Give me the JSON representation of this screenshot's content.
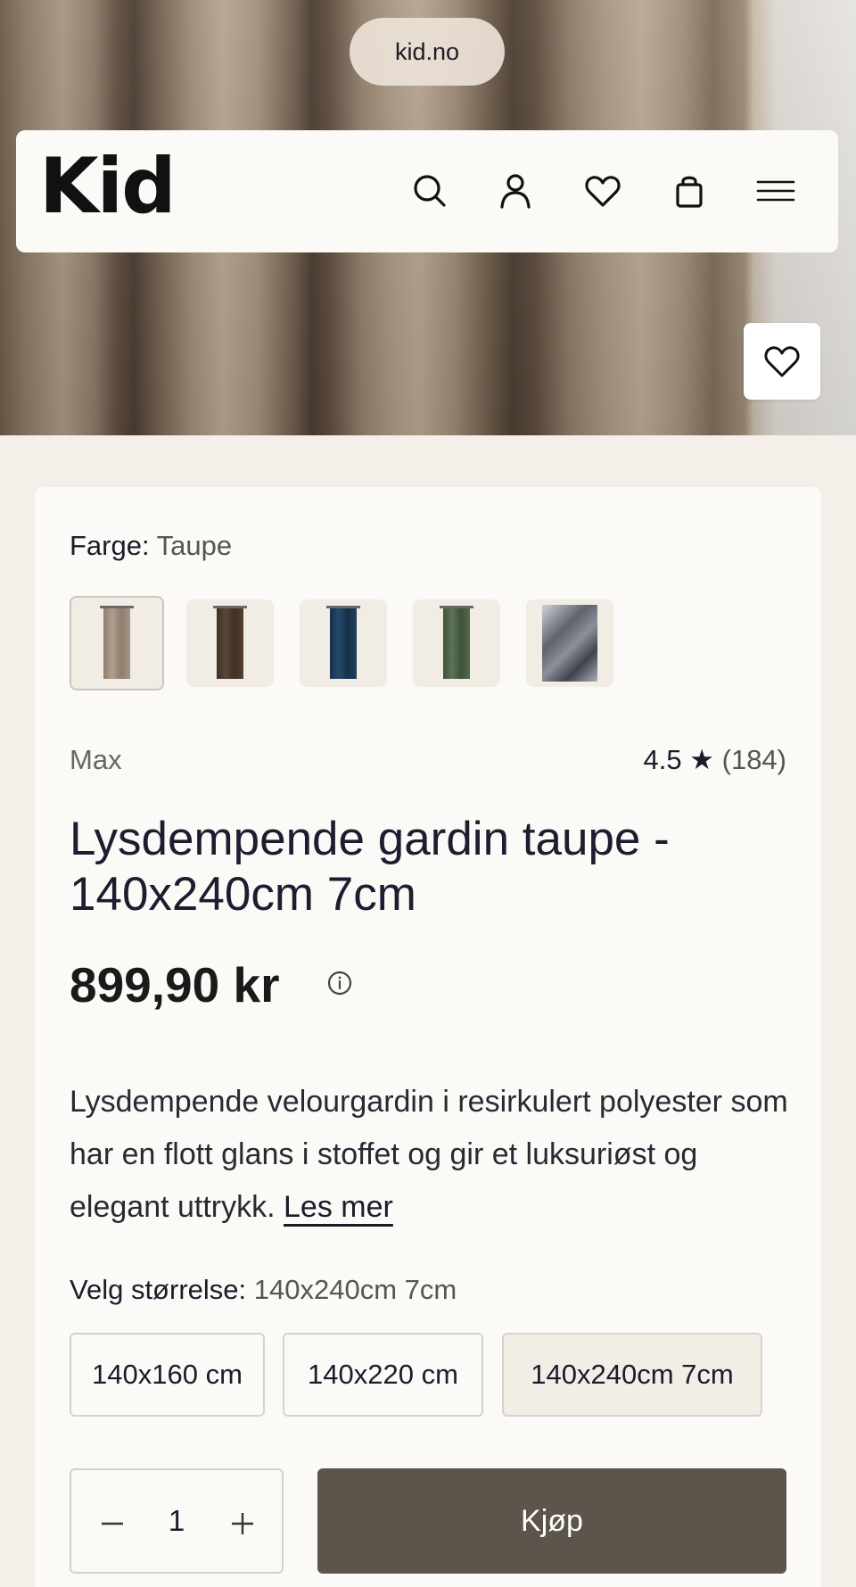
{
  "browser": {
    "url": "kid.no"
  },
  "header": {
    "logo": "Kid",
    "icons": [
      "search-icon",
      "account-icon",
      "heart-icon",
      "bag-icon",
      "menu-icon"
    ]
  },
  "colors": {
    "button_dark": "#5d554c",
    "card_bg": "#fbfaf7",
    "page_bg": "#f4f0e9"
  },
  "product": {
    "color_label": "Farge:",
    "color_value": "Taupe",
    "swatches": [
      {
        "name": "Taupe",
        "color": "#9e8e7e",
        "selected": true
      },
      {
        "name": "Brown",
        "color": "#4a3a2e",
        "selected": false
      },
      {
        "name": "Blue",
        "color": "#1f3a52",
        "selected": false
      },
      {
        "name": "Green",
        "color": "#4e6247",
        "selected": false
      },
      {
        "name": "Photo",
        "color": "#6b7079",
        "selected": false
      }
    ],
    "brand": "Max",
    "rating": "4.5 ★",
    "review_count": "(184)",
    "title": "Lysdempende gardin taupe - 140x240cm 7cm",
    "price": "899,90 kr",
    "description": "Lysdempende velourgardin i resirkulert polyester som har en flott glans i stoffet og gir et luksuriøst og elegant uttrykk. ",
    "read_more": "Les mer",
    "size_label": "Velg størrelse:",
    "size_value": "140x240cm 7cm",
    "sizes": [
      "140x160 cm",
      "140x220 cm",
      "140x240cm 7cm"
    ],
    "quantity": "1",
    "buy_label": "Kjøp"
  }
}
